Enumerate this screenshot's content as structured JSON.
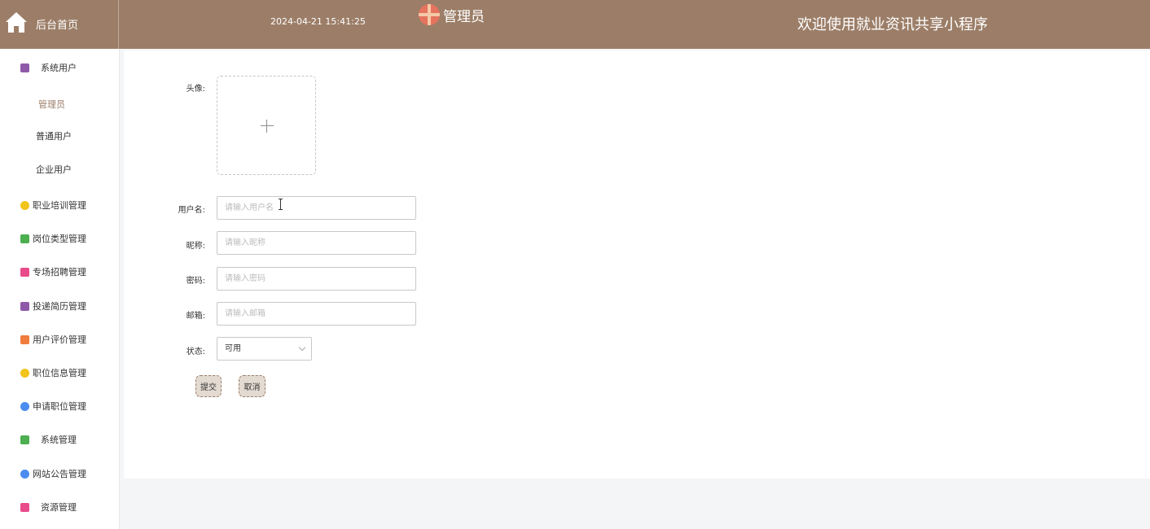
{
  "header": {
    "home_label": "后台首页",
    "datetime": "2024-04-21 15:41:25",
    "admin_name": "管理员",
    "welcome": "欢迎使用就业资讯共享小程序",
    "bar_color": "#9c7e68"
  },
  "sidebar": {
    "groups": [
      {
        "label": "系统用户",
        "icon": "archive-icon",
        "color": "#8e5aa8"
      },
      {
        "label": "职业培训管理",
        "icon": "hexagon-icon",
        "color": "#f0c419"
      },
      {
        "label": "岗位类型管理",
        "icon": "chat-icon",
        "color": "#4caf50"
      },
      {
        "label": "专场招聘管理",
        "icon": "bag-icon",
        "color": "#e84a8a"
      },
      {
        "label": "投递简历管理",
        "icon": "archive-icon",
        "color": "#8e5aa8"
      },
      {
        "label": "用户评价管理",
        "icon": "grid-icon",
        "color": "#f07c3e"
      },
      {
        "label": "职位信息管理",
        "icon": "hexagon-icon",
        "color": "#f0c419"
      },
      {
        "label": "申请职位管理",
        "icon": "star-icon",
        "color": "#4a8cf0"
      },
      {
        "label": "系统管理",
        "icon": "chat-icon",
        "color": "#4caf50"
      },
      {
        "label": "网站公告管理",
        "icon": "star-icon",
        "color": "#4a8cf0"
      },
      {
        "label": "资源管理",
        "icon": "bag-icon",
        "color": "#e84a8a"
      }
    ],
    "subitems": [
      "管理员",
      "普通用户",
      "企业用户"
    ]
  },
  "form": {
    "avatar_label": "头像:",
    "username_label": "用户名:",
    "username_placeholder": "请输入用户名",
    "nickname_label": "昵称:",
    "nickname_placeholder": "请输入昵称",
    "password_label": "密码:",
    "password_placeholder": "请输入密码",
    "email_label": "邮箱:",
    "email_placeholder": "请输入邮箱",
    "status_label": "状态:",
    "status_value": "可用",
    "submit_label": "提交",
    "cancel_label": "取消"
  }
}
